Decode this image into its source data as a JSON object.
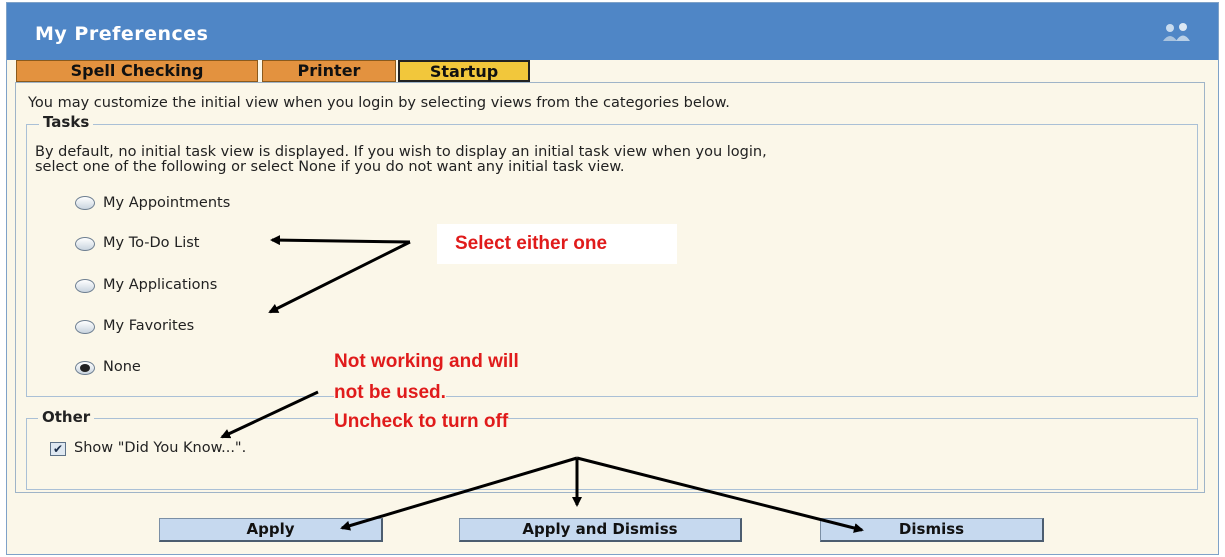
{
  "window": {
    "title": "My Preferences",
    "title_icon": "people-icon"
  },
  "tabs": [
    {
      "label": "Spell Checking",
      "active": false
    },
    {
      "label": "Printer",
      "active": false
    },
    {
      "label": "Startup",
      "active": true
    }
  ],
  "intro": "You may customize the initial view when you login by selecting views from the categories below.",
  "tasks": {
    "legend": "Tasks",
    "description_line1": "By default, no initial task view is displayed. If you wish to display an initial task view when you login,",
    "description_line2": "select one of the following or select None if you do not want any initial task view.",
    "options": [
      {
        "label": "My Appointments",
        "selected": false
      },
      {
        "label": "My To-Do List",
        "selected": false
      },
      {
        "label": "My Applications",
        "selected": false
      },
      {
        "label": "My Favorites",
        "selected": false
      },
      {
        "label": "None",
        "selected": true
      }
    ]
  },
  "other": {
    "legend": "Other",
    "checkbox_label": "Show \"Did You Know...\".",
    "checked": true
  },
  "buttons": {
    "apply": "Apply",
    "apply_dismiss": "Apply and Dismiss",
    "dismiss": "Dismiss"
  },
  "annotations": {
    "select_either": "Select either one",
    "note_line1": "Not working and will",
    "note_line2": "not be used.",
    "note_line3": "Uncheck to turn off"
  },
  "colors": {
    "titlebar": "#4f86c6",
    "tab_inactive": "#e3923f",
    "tab_active": "#f2c73b",
    "annotation": "#e01b1b",
    "button": "#c6d9ef"
  }
}
